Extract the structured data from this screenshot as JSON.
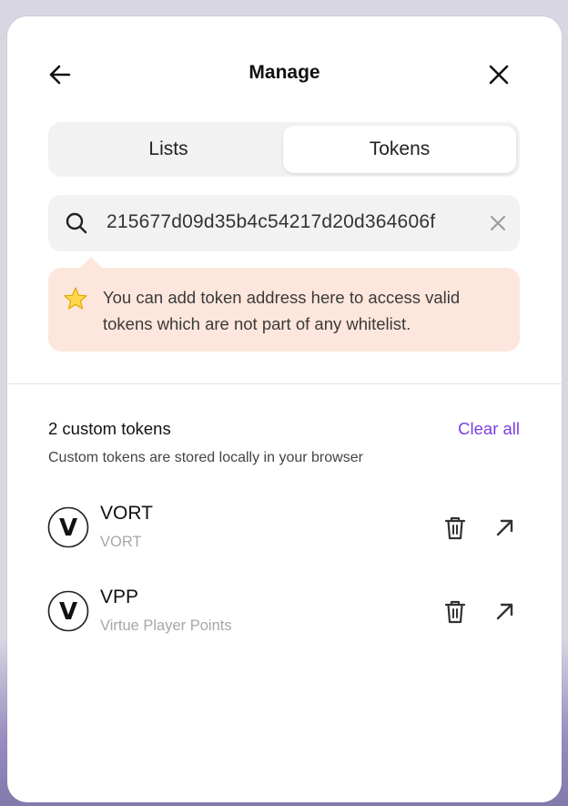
{
  "header": {
    "title": "Manage",
    "back_icon": "arrow-left-icon",
    "close_icon": "close-icon"
  },
  "tabs": [
    {
      "label": "Lists",
      "active": false
    },
    {
      "label": "Tokens",
      "active": true
    }
  ],
  "search": {
    "value": "215677d09d35b4c54217d20d364606f",
    "icon": "search-icon",
    "clear_icon": "clear-x-icon"
  },
  "notice": {
    "icon": "star-icon",
    "text": "You can add token address here to access valid tokens which are not part of any whitelist."
  },
  "custom": {
    "count_label": "2 custom tokens",
    "clear_all_label": "Clear all",
    "hint": "Custom tokens are stored locally in your browser"
  },
  "tokens": [
    {
      "logo_letter": "V",
      "symbol": "VORT",
      "name": "VORT"
    },
    {
      "logo_letter": "V",
      "symbol": "VPP",
      "name": "Virtue Player Points"
    }
  ],
  "colors": {
    "accent": "#7b3fe4",
    "notice_bg": "#fde7dd",
    "control_bg": "#f2f2f3"
  }
}
